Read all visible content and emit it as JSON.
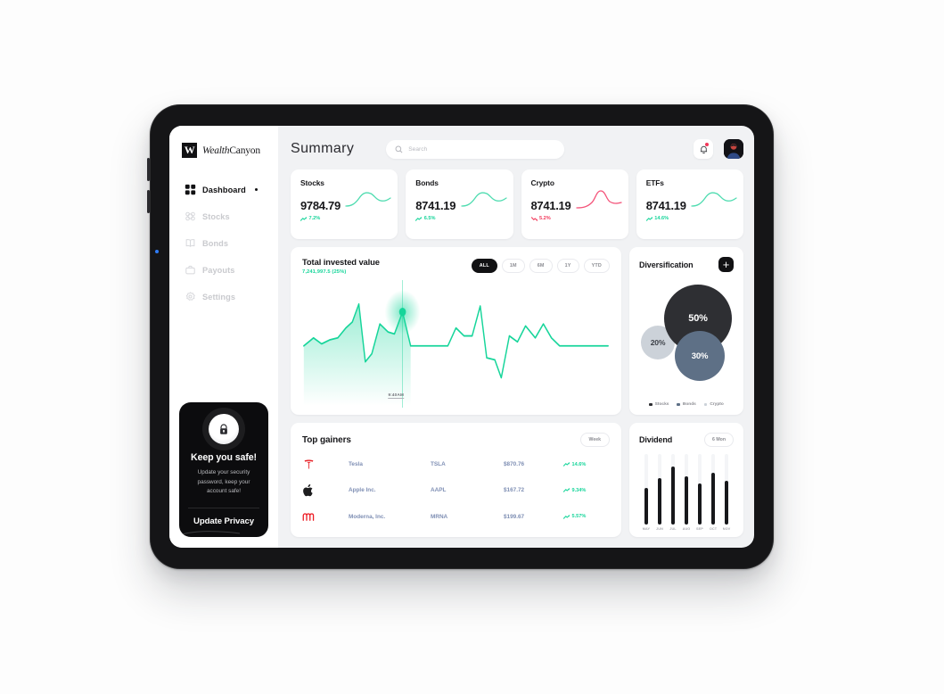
{
  "brand": {
    "mark": "W",
    "name_bold": "Wealth",
    "name_rest": "Canyon"
  },
  "sidebar": {
    "items": [
      {
        "label": "Dashboard",
        "icon": "grid-icon",
        "active": true
      },
      {
        "label": "Stocks",
        "icon": "stocks-icon",
        "active": false
      },
      {
        "label": "Bonds",
        "icon": "book-icon",
        "active": false
      },
      {
        "label": "Payouts",
        "icon": "briefcase-icon",
        "active": false
      },
      {
        "label": "Settings",
        "icon": "gear-icon",
        "active": false
      }
    ],
    "promo": {
      "title": "Keep you safe!",
      "subtitle": "Update your security password, keep your account safe!",
      "button": "Update Privacy",
      "icon": "lock-icon"
    }
  },
  "header": {
    "title": "Summary",
    "search": {
      "value": "",
      "placeholder": "Search",
      "icon": "search-icon"
    },
    "notifications": {
      "icon": "bell-icon",
      "has_badge": true
    },
    "avatar": {
      "icon": "avatar"
    }
  },
  "stats": [
    {
      "name": "Stocks",
      "value": "9784.79",
      "delta": "7.2%",
      "direction": "up",
      "color": "#16d59a"
    },
    {
      "name": "Bonds",
      "value": "8741.19",
      "delta": "6.5%",
      "direction": "up",
      "color": "#16d59a"
    },
    {
      "name": "Crypto",
      "value": "8741.19",
      "delta": "5.2%",
      "direction": "down",
      "color": "#f2385a"
    },
    {
      "name": "ETFs",
      "value": "8741.19",
      "delta": "14.6%",
      "direction": "up",
      "color": "#16d59a"
    }
  ],
  "invested": {
    "title": "Total invested value",
    "subtitle": "7,241,997.5 (25%)",
    "ranges": [
      {
        "label": "ALL",
        "active": true
      },
      {
        "label": "1M",
        "active": false
      },
      {
        "label": "6M",
        "active": false
      },
      {
        "label": "1Y",
        "active": false
      },
      {
        "label": "YTD",
        "active": false
      }
    ],
    "marker_label": "9:40AM"
  },
  "diversification": {
    "title": "Diversification",
    "add_button": "+",
    "slices": [
      {
        "label": "Stocks",
        "value": "50%",
        "color": "#2e2f33"
      },
      {
        "label": "Bonds",
        "value": "30%",
        "color": "#5e7086"
      },
      {
        "label": "Crypto",
        "value": "20%",
        "color": "#ccd2d9"
      }
    ]
  },
  "top_gainers": {
    "title": "Top gainers",
    "range": "Week",
    "rows": [
      {
        "logo": "tesla-logo",
        "name": "Tesla",
        "symbol": "TSLA",
        "price": "$870.76",
        "change": "14.6%",
        "direction": "up"
      },
      {
        "logo": "apple-logo",
        "name": "Apple Inc.",
        "symbol": "AAPL",
        "price": "$167.72",
        "change": "9.34%",
        "direction": "up"
      },
      {
        "logo": "moderna-logo",
        "name": "Moderna, Inc.",
        "symbol": "MRNA",
        "price": "$199.67",
        "change": "5.57%",
        "direction": "up"
      }
    ]
  },
  "dividend": {
    "title": "Dividend",
    "range": "6 Mon"
  },
  "chart_data": [
    {
      "type": "line",
      "title": "Total invested value",
      "name": "total-invested-value-line",
      "xlabel": "",
      "ylabel": "",
      "grid": false,
      "legend": "none",
      "marker": {
        "x_label": "9:40AM",
        "index": 17,
        "value": 62
      },
      "ylim": [
        0,
        100
      ],
      "x": [
        0,
        1,
        2,
        3,
        4,
        5,
        6,
        7,
        8,
        9,
        10,
        11,
        12,
        13,
        14,
        15,
        16,
        17,
        18,
        19,
        20,
        21,
        22,
        23,
        24,
        25,
        26,
        27,
        28,
        29,
        30,
        31,
        32,
        33,
        34,
        35,
        36,
        37,
        38,
        39,
        40
      ],
      "series": [
        {
          "name": "Invested value",
          "values": [
            30,
            30,
            40,
            42,
            33,
            37,
            38,
            47,
            52,
            72,
            72,
            30,
            18,
            22,
            44,
            54,
            42,
            44,
            62,
            62,
            42,
            36,
            36,
            36,
            36,
            36,
            36,
            36,
            36,
            55,
            42,
            42,
            68,
            28,
            24,
            24,
            10,
            48,
            44,
            38,
            52,
            48,
            52,
            36,
            36
          ]
        }
      ]
    },
    {
      "type": "bar",
      "title": "Dividend",
      "name": "dividend-bar-chart",
      "categories": [
        "MAY",
        "JUN",
        "JUL",
        "AUG",
        "SEP",
        "OCT",
        "NOV"
      ],
      "values": [
        52,
        66,
        82,
        68,
        58,
        74,
        62
      ],
      "ylim": [
        0,
        100
      ],
      "grid": false,
      "legend": "none"
    },
    {
      "type": "pie",
      "title": "Diversification",
      "name": "diversification-bubbles",
      "labels": [
        "Stocks",
        "Bonds",
        "Crypto"
      ],
      "values": [
        50,
        30,
        20
      ],
      "colors": [
        "#2e2f33",
        "#5e7086",
        "#ccd2d9"
      ],
      "legend": "bottom"
    },
    {
      "type": "line",
      "title": "Stocks sparkline",
      "name": "stocks-sparkline",
      "values": [
        20,
        22,
        30,
        55,
        70,
        66,
        58,
        60,
        64
      ],
      "legend": "none",
      "grid": false
    },
    {
      "type": "line",
      "title": "Bonds sparkline",
      "name": "bonds-sparkline",
      "values": [
        20,
        22,
        30,
        55,
        70,
        66,
        58,
        60,
        64
      ],
      "legend": "none",
      "grid": false
    },
    {
      "type": "line",
      "title": "Crypto sparkline",
      "name": "crypto-sparkline",
      "values": [
        14,
        16,
        22,
        78,
        86,
        52,
        44,
        42,
        40
      ],
      "legend": "none",
      "grid": false
    },
    {
      "type": "line",
      "title": "ETFs sparkline",
      "name": "etfs-sparkline",
      "values": [
        20,
        22,
        30,
        55,
        70,
        66,
        58,
        60,
        64
      ],
      "legend": "none",
      "grid": false
    }
  ]
}
